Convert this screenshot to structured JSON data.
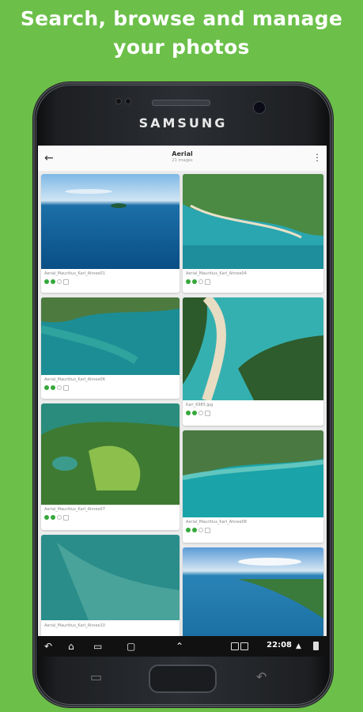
{
  "headline": [
    "Search, browse and manage",
    "your photos"
  ],
  "device": {
    "brand": "SAMSUNG"
  },
  "appbar": {
    "back_icon": "back-arrow-icon",
    "title": "Aerial",
    "subtitle": "21 images",
    "menu_icon": "overflow-menu-icon"
  },
  "photos": [
    {
      "filename": "Aerial_Mauritius_Karl_Ahnee01"
    },
    {
      "filename": "Aerial_Mauritius_Karl_Ahnee04"
    },
    {
      "filename": "Aerial_Mauritius_Karl_Ahnee06"
    },
    {
      "filename": "Karl_6985.jpg"
    },
    {
      "filename": "Aerial_Mauritius_Karl_Ahnee07"
    },
    {
      "filename": "Aerial_Mauritius_Karl_Ahnee08"
    },
    {
      "filename": "Aerial_Mauritius_Karl_Ahnee10"
    },
    {
      "filename": ""
    }
  ],
  "statusbar": {
    "time": "22:08"
  },
  "colors": {
    "background": "#6cc04a",
    "status_green": "#35a83b"
  }
}
